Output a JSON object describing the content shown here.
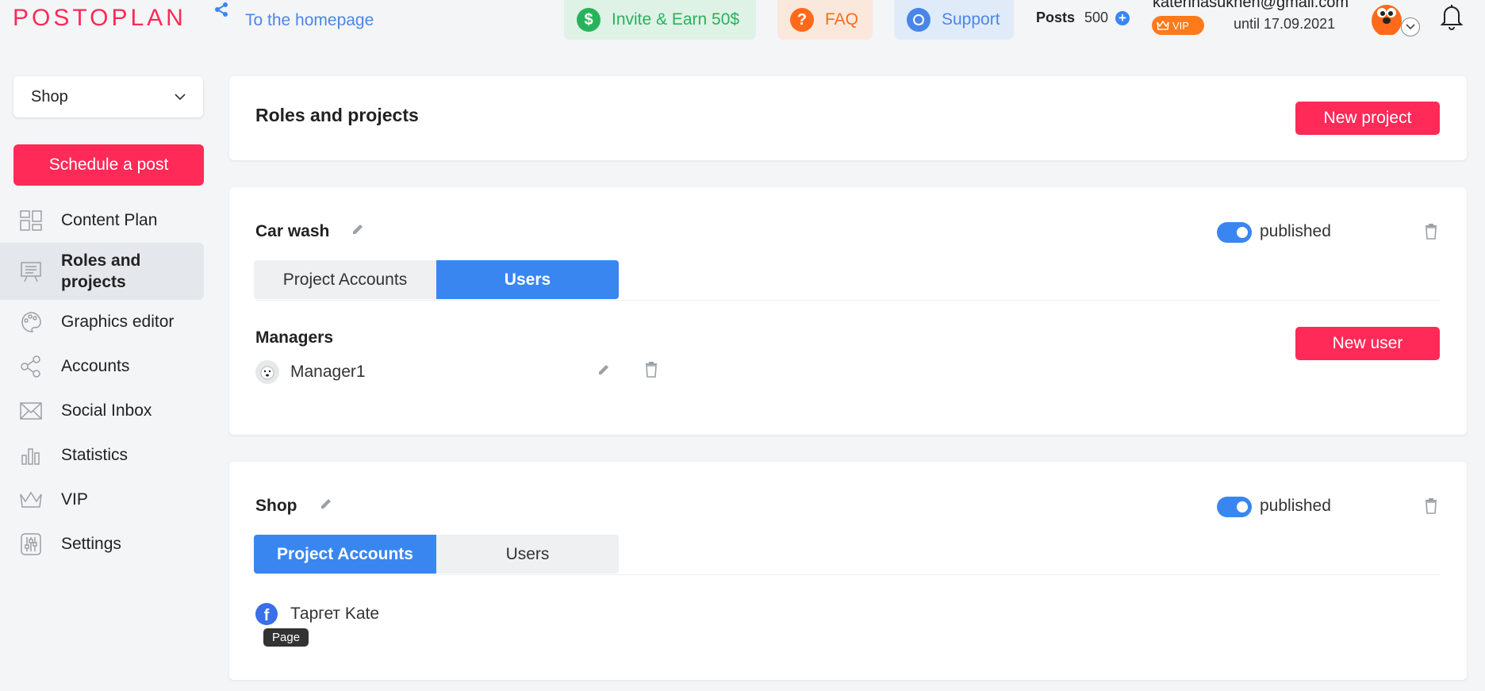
{
  "header": {
    "logo": "POSTOPLAN",
    "home_link": "To the homepage",
    "invite": "Invite & Earn 50$",
    "faq": "FAQ",
    "support": "Support",
    "posts_label": "Posts",
    "posts_count": "500",
    "email": "katerinasukhen@gmail.com",
    "vip": "VIP",
    "until": "until 17.09.2021"
  },
  "sidebar": {
    "project_select": "Shop",
    "schedule_button": "Schedule a post",
    "items": [
      {
        "label": "Content Plan",
        "icon": "content-plan-icon"
      },
      {
        "label": "Roles and projects",
        "icon": "roles-icon"
      },
      {
        "label": "Graphics editor",
        "icon": "palette-icon"
      },
      {
        "label": "Accounts",
        "icon": "share-icon"
      },
      {
        "label": "Social Inbox",
        "icon": "envelope-icon"
      },
      {
        "label": "Statistics",
        "icon": "bar-chart-icon"
      },
      {
        "label": "VIP",
        "icon": "crown-icon"
      },
      {
        "label": "Settings",
        "icon": "sliders-icon"
      }
    ]
  },
  "main": {
    "title": "Roles and projects",
    "new_project": "New project",
    "projects": [
      {
        "name": "Car wash",
        "status": "published",
        "tabs": [
          "Project Accounts",
          "Users"
        ],
        "active_tab": "Users",
        "section": "Managers",
        "new_user": "New user",
        "users": [
          {
            "name": "Manager1"
          }
        ]
      },
      {
        "name": "Shop",
        "status": "published",
        "tabs": [
          "Project Accounts",
          "Users"
        ],
        "active_tab": "Project Accounts",
        "accounts": [
          {
            "name": "Таргет Kate",
            "type": "Page"
          }
        ]
      }
    ]
  },
  "colors": {
    "brand": "#ff2a57",
    "accent": "#3a86f1",
    "invite": "#27b35c",
    "faq": "#ff6a1a"
  }
}
